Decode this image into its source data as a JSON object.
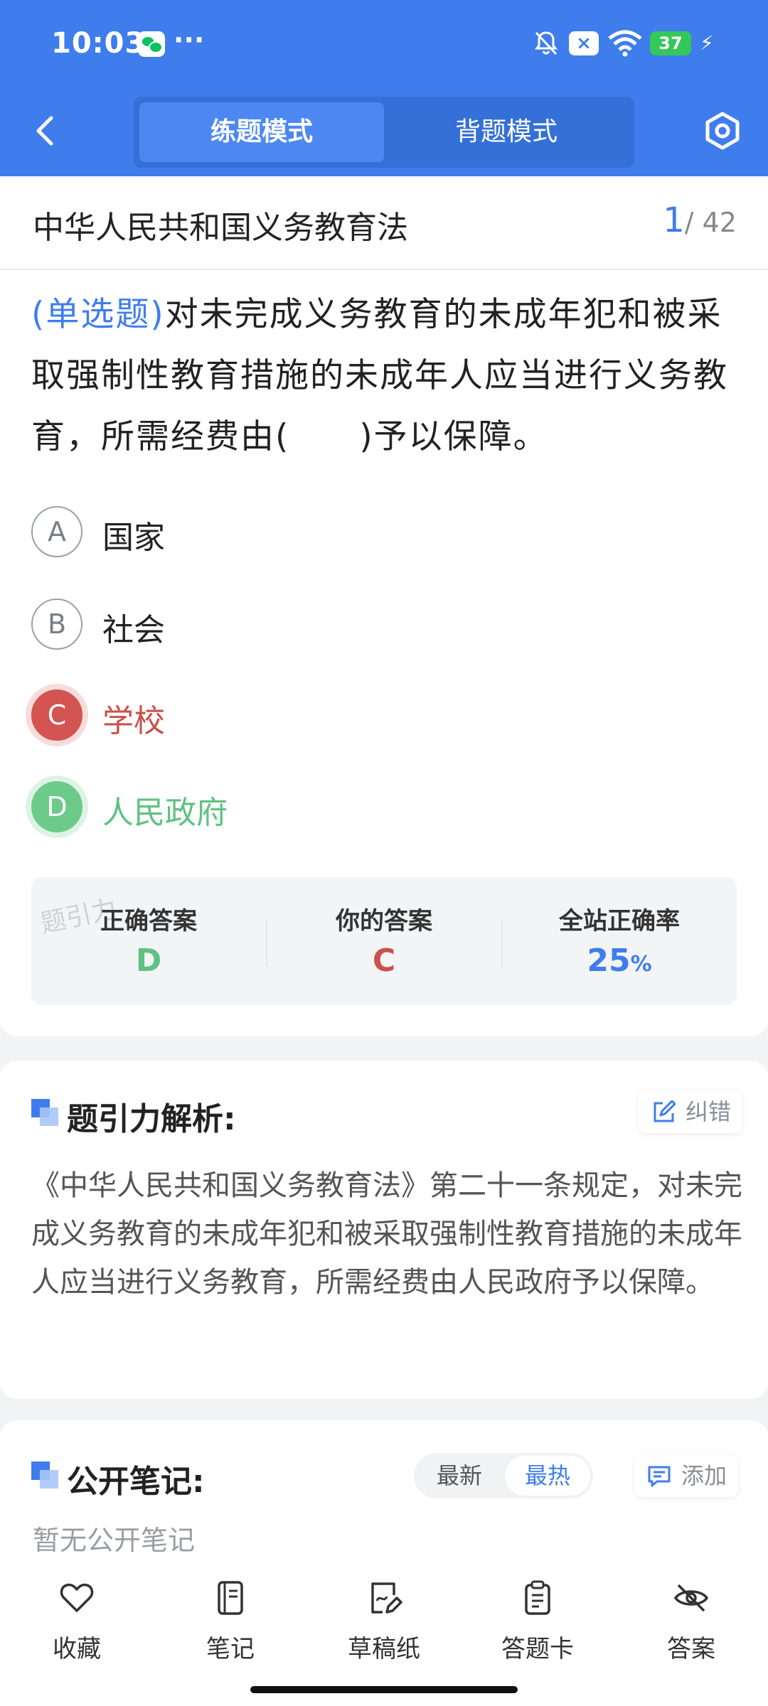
{
  "status": {
    "time": "10:03",
    "more": "···",
    "battery": "37"
  },
  "header": {
    "mode_practice": "练题模式",
    "mode_memorize": "背题模式"
  },
  "question": {
    "subject": "中华人民共和国义务教育法",
    "current": "1",
    "total": "/ 42",
    "type": "(单选题)",
    "text": "对未完成义务教育的未成年犯和被采取强制性教育措施的未成年人应当进行义务教育，所需经费由(　　)予以保障。",
    "options": [
      {
        "letter": "A",
        "text": "国家"
      },
      {
        "letter": "B",
        "text": "社会"
      },
      {
        "letter": "C",
        "text": "学校"
      },
      {
        "letter": "D",
        "text": "人民政府"
      }
    ]
  },
  "stats": {
    "watermark": "题引力",
    "correct_label": "正确答案",
    "correct_value": "D",
    "your_label": "你的答案",
    "your_value": "C",
    "rate_label": "全站正确率",
    "rate_value": "25",
    "rate_unit": "%"
  },
  "analysis": {
    "title": "题引力解析:",
    "report_label": "纠错",
    "text": "《中华人民共和国义务教育法》第二十一条规定，对未完成义务教育的未成年犯和被采取强制性教育措施的未成年人应当进行义务教育，所需经费由人民政府予以保障。"
  },
  "notes": {
    "title": "公开笔记:",
    "sort_latest": "最新",
    "sort_hot": "最热",
    "add_label": "添加",
    "empty": "暂无公开笔记"
  },
  "nav": {
    "favorite": "收藏",
    "notes": "笔记",
    "draft": "草稿纸",
    "answer_card": "答题卡",
    "answer": "答案"
  },
  "colors": {
    "primary": "#3f7ded",
    "wrong": "#d35450",
    "correct": "#6ccb8a"
  }
}
